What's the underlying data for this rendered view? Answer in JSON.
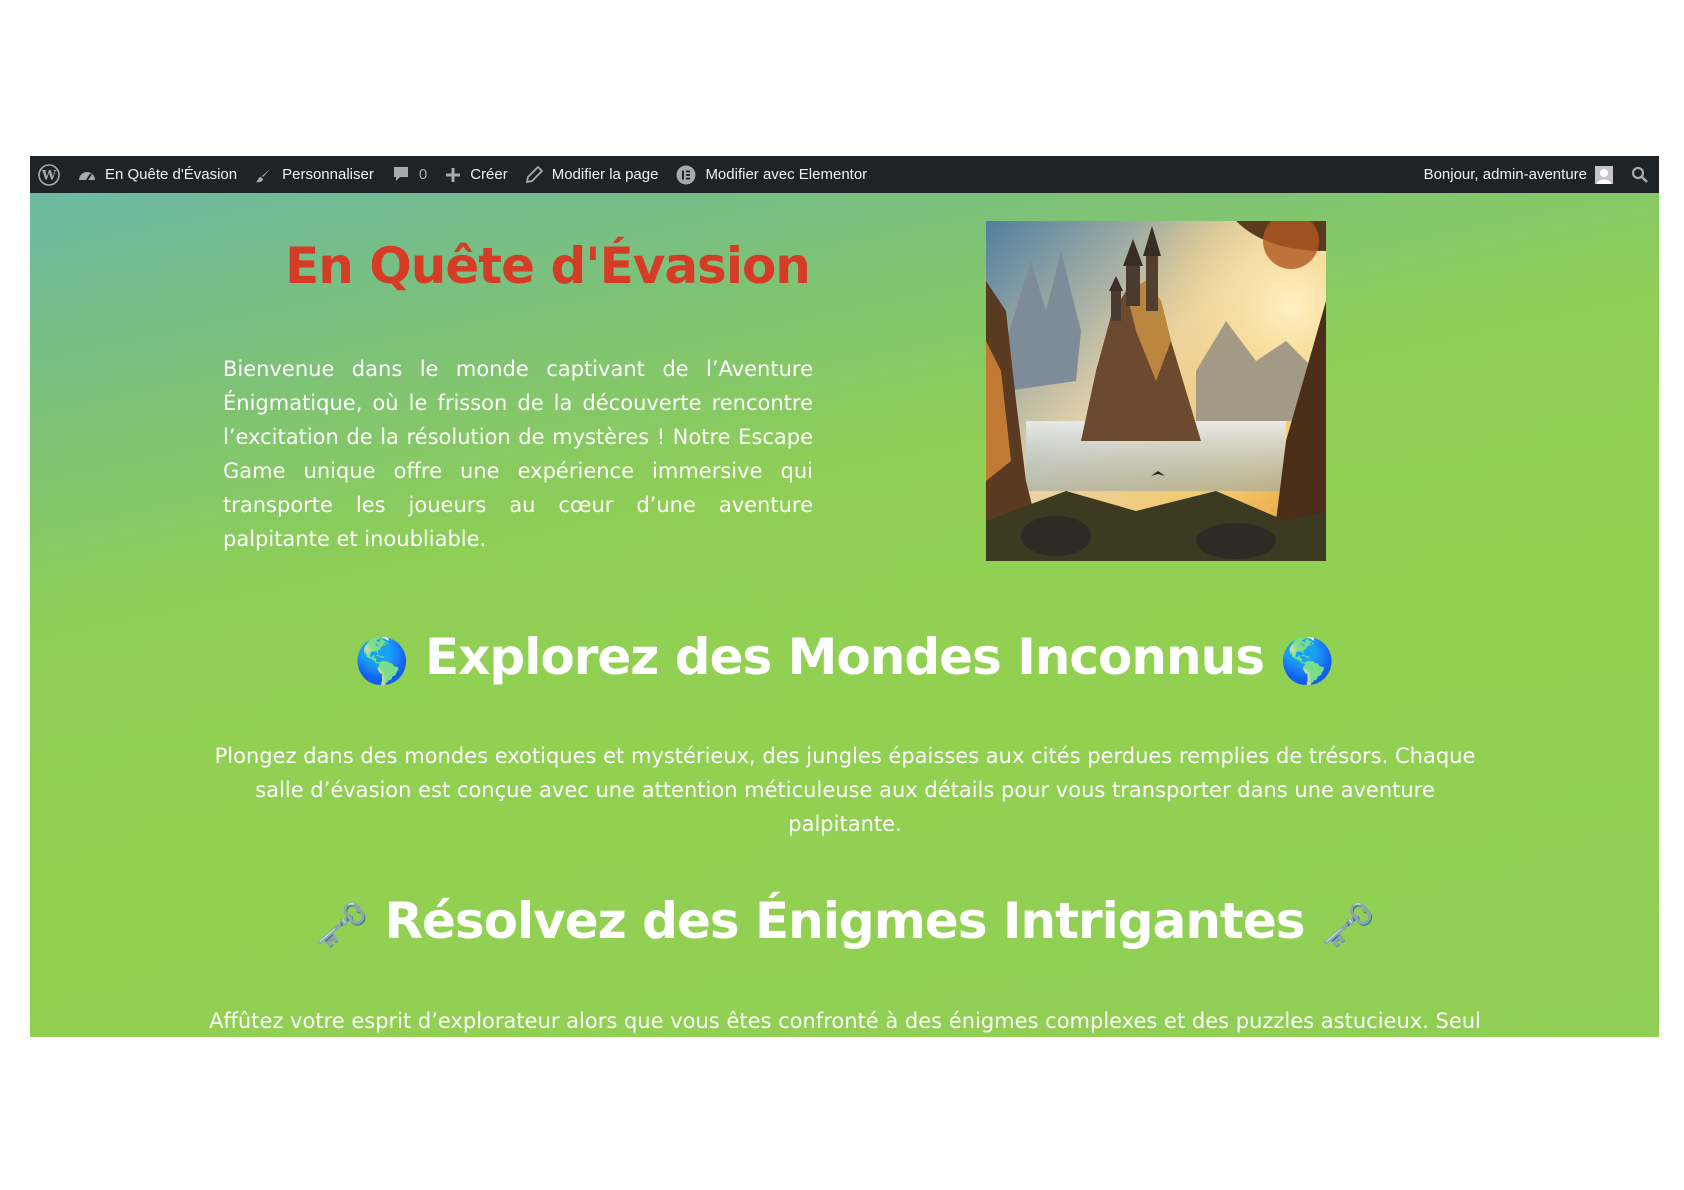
{
  "admin_bar": {
    "site_name": "En Quête d'Évasion",
    "customize": "Personnaliser",
    "comments_count": "0",
    "new": "Créer",
    "edit_page": "Modifier la page",
    "edit_elementor": "Modifier avec Elementor",
    "greeting": "Bonjour, admin-aventure"
  },
  "hero": {
    "title": "En Quête d'Évasion",
    "text": "Bienvenue dans le monde captivant de l’Aventure Énigmatique, où le frisson de la découverte rencontre l’excitation de la résolution de mystères ! Notre Escape Game unique offre une expérience immersive qui transporte les joueurs au cœur d’une aventure palpitante et inoubliable."
  },
  "sections": [
    {
      "emoji": "🌎",
      "title": "Explorez des Mondes Inconnus",
      "text": "Plongez dans des mondes exotiques et mystérieux, des jungles épaisses aux cités perdues remplies de trésors. Chaque salle d’évasion est conçue avec une attention méticuleuse aux détails pour vous transporter dans une aventure palpitante."
    },
    {
      "emoji": "🗝️",
      "title": "Résolvez des Énigmes Intrigantes",
      "text": "Affûtez votre esprit d’explorateur alors que vous êtes confronté à des énigmes complexes et des puzzles astucieux. Seul"
    }
  ],
  "colors": {
    "admin_bar_bg": "#1d2327",
    "hero_title": "#d63b25",
    "page_gradient_start": "#6bb9a2",
    "page_gradient_end": "#92d051"
  },
  "icons": {
    "wordpress_logo": "wordpress-icon",
    "dashboard": "dashboard-icon",
    "customize": "brush-icon",
    "comments": "comment-icon",
    "new": "plus-icon",
    "edit": "pencil-icon",
    "elementor": "elementor-icon",
    "search": "search-icon"
  }
}
